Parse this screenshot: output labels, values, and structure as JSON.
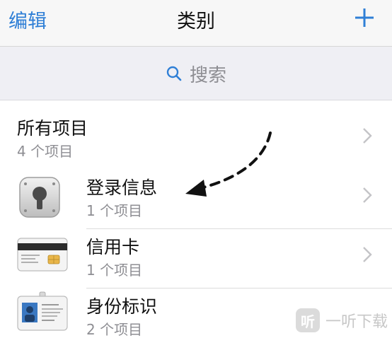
{
  "nav": {
    "edit_label": "编辑",
    "title": "类别",
    "add_icon": "plus-icon"
  },
  "search": {
    "placeholder": "搜索",
    "icon": "search-icon"
  },
  "categories": [
    {
      "title": "所有项目",
      "count": "4 个项目",
      "icon": ""
    },
    {
      "title": "登录信息",
      "count": "1 个项目",
      "icon": "keyhole-safe-icon"
    },
    {
      "title": "信用卡",
      "count": "1 个项目",
      "icon": "credit-card-icon"
    },
    {
      "title": "身份标识",
      "count": "2 个项目",
      "icon": "id-card-icon"
    }
  ],
  "watermark": {
    "badge": "听",
    "text": "一听下载"
  },
  "colors": {
    "accent": "#2f7fd6",
    "secondary_text": "#8e8e93",
    "search_bg": "#efeff4"
  }
}
